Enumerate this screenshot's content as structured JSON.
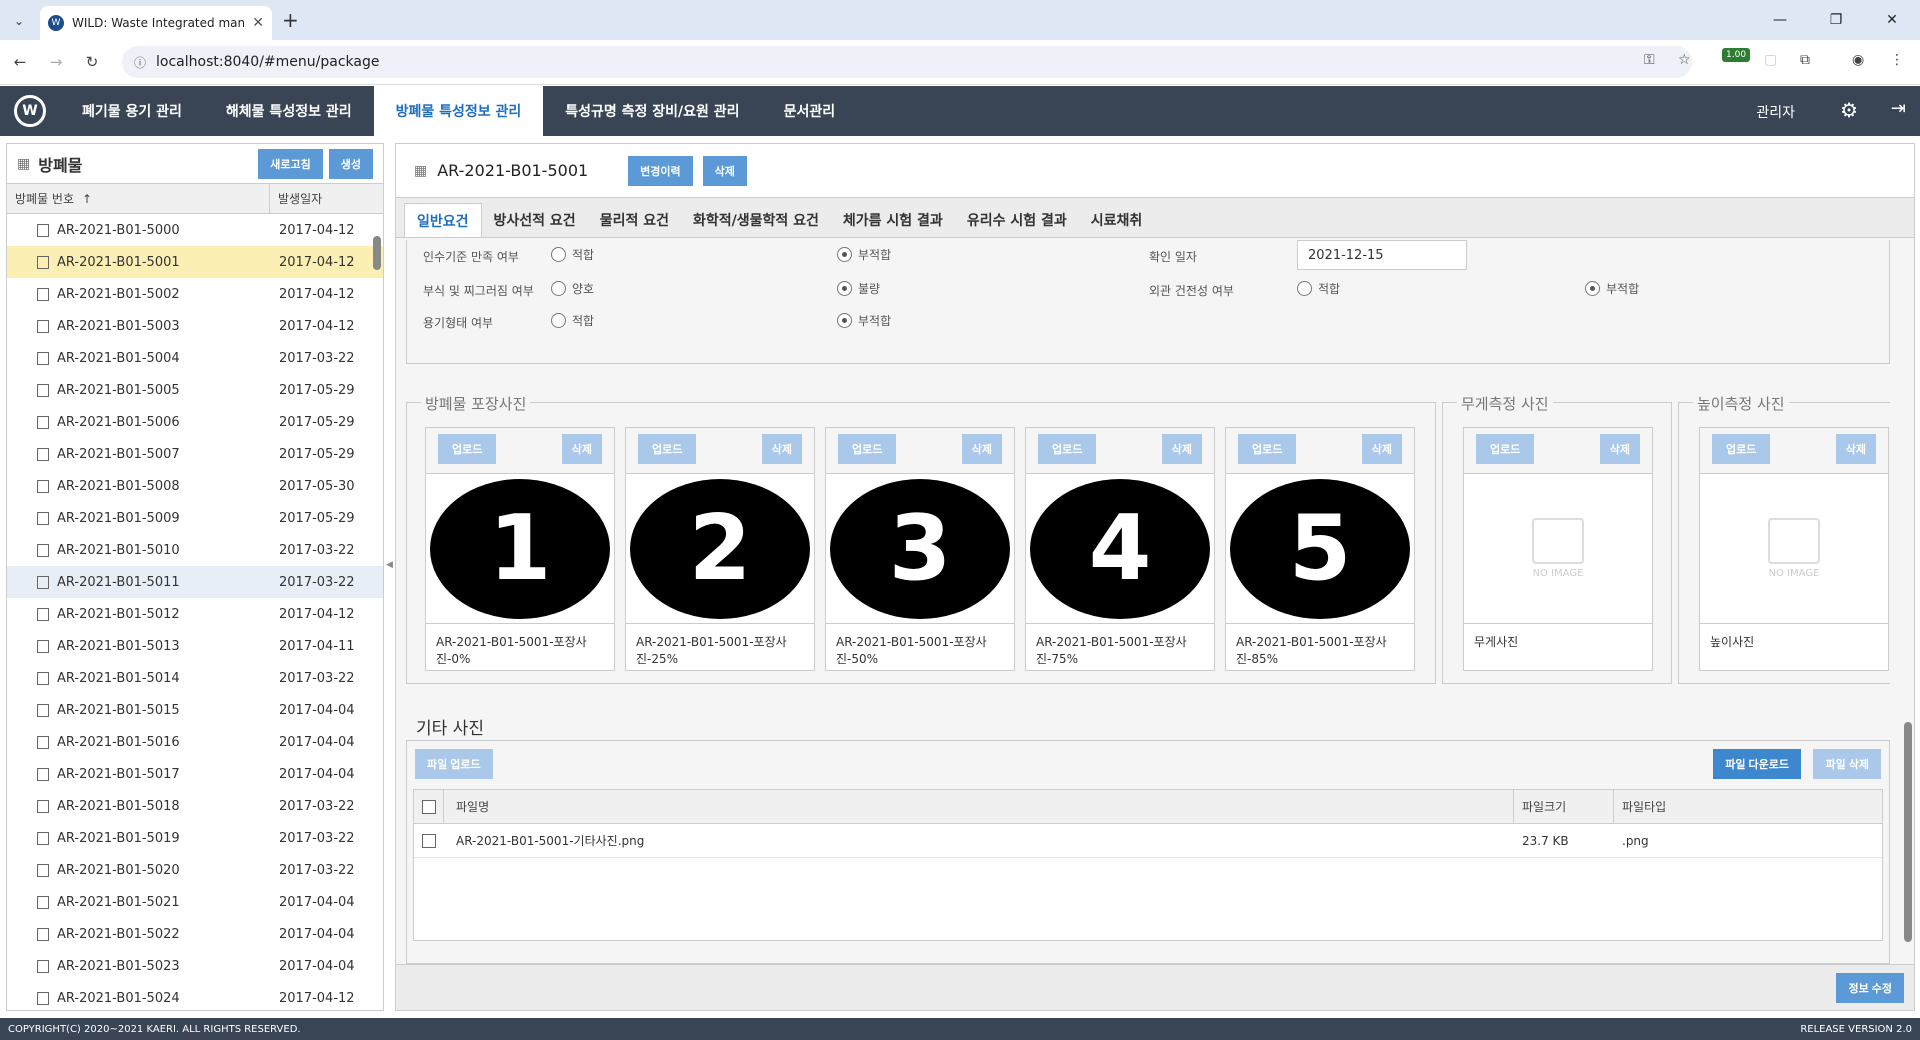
{
  "browser": {
    "tab_title": "WILD: Waste Integrated mana",
    "url": "localhost:8040/#menu/package",
    "ext_badge": "1.00"
  },
  "app": {
    "logo_text": "W",
    "menu": [
      {
        "label": "폐기물 용기 관리"
      },
      {
        "label": "해체물 특성정보 관리"
      },
      {
        "label": "방폐물 특성정보 관리"
      },
      {
        "label": "특성규명 측정 장비/요원 관리"
      },
      {
        "label": "문서관리"
      }
    ],
    "user": "관리자"
  },
  "left": {
    "title": "방폐물",
    "refresh_label": "새로고침",
    "create_label": "생성",
    "col_id": "방폐물 번호",
    "col_date": "발생일자",
    "sort_icon": "↑",
    "rows": [
      {
        "id": "AR-2021-B01-5000",
        "date": "2017-04-12"
      },
      {
        "id": "AR-2021-B01-5001",
        "date": "2017-04-12"
      },
      {
        "id": "AR-2021-B01-5002",
        "date": "2017-04-12"
      },
      {
        "id": "AR-2021-B01-5003",
        "date": "2017-04-12"
      },
      {
        "id": "AR-2021-B01-5004",
        "date": "2017-03-22"
      },
      {
        "id": "AR-2021-B01-5005",
        "date": "2017-05-29"
      },
      {
        "id": "AR-2021-B01-5006",
        "date": "2017-05-29"
      },
      {
        "id": "AR-2021-B01-5007",
        "date": "2017-05-29"
      },
      {
        "id": "AR-2021-B01-5008",
        "date": "2017-05-30"
      },
      {
        "id": "AR-2021-B01-5009",
        "date": "2017-05-29"
      },
      {
        "id": "AR-2021-B01-5010",
        "date": "2017-03-22"
      },
      {
        "id": "AR-2021-B01-5011",
        "date": "2017-03-22"
      },
      {
        "id": "AR-2021-B01-5012",
        "date": "2017-04-12"
      },
      {
        "id": "AR-2021-B01-5013",
        "date": "2017-04-11"
      },
      {
        "id": "AR-2021-B01-5014",
        "date": "2017-03-22"
      },
      {
        "id": "AR-2021-B01-5015",
        "date": "2017-04-04"
      },
      {
        "id": "AR-2021-B01-5016",
        "date": "2017-04-04"
      },
      {
        "id": "AR-2021-B01-5017",
        "date": "2017-04-04"
      },
      {
        "id": "AR-2021-B01-5018",
        "date": "2017-03-22"
      },
      {
        "id": "AR-2021-B01-5019",
        "date": "2017-03-22"
      },
      {
        "id": "AR-2021-B01-5020",
        "date": "2017-03-22"
      },
      {
        "id": "AR-2021-B01-5021",
        "date": "2017-04-04"
      },
      {
        "id": "AR-2021-B01-5022",
        "date": "2017-04-04"
      },
      {
        "id": "AR-2021-B01-5023",
        "date": "2017-04-04"
      },
      {
        "id": "AR-2021-B01-5024",
        "date": "2017-04-12"
      }
    ]
  },
  "detail": {
    "title": "AR-2021-B01-5001",
    "history_label": "변경이력",
    "delete_label": "삭제",
    "tabs": [
      {
        "label": "일반요건"
      },
      {
        "label": "방사선적 요건"
      },
      {
        "label": "물리적 요건"
      },
      {
        "label": "화학적/생물학적 요건"
      },
      {
        "label": "체가름 시험 결과"
      },
      {
        "label": "유리수 시험 결과"
      },
      {
        "label": "시료채취"
      }
    ],
    "form": {
      "accept_label": "인수기준 만족 여부",
      "accept_opt1": "적합",
      "accept_opt2": "부적합",
      "confirm_date_label": "확인 일자",
      "confirm_date": "2021-12-15",
      "corrosion_label": "부식 및 찌그러짐 여부",
      "corrosion_opt1": "양호",
      "corrosion_opt2": "불량",
      "soundness_label": "외관 건전성 여부",
      "soundness_opt1": "적합",
      "soundness_opt2": "부적합",
      "container_label": "용기형태 여부",
      "container_opt1": "적합",
      "container_opt2": "부적합"
    },
    "packaging": {
      "legend": "방폐물 포장사진",
      "upload_label": "업로드",
      "delete_label": "삭제",
      "photos": [
        {
          "num": "1",
          "caption": "AR-2021-B01-5001-포장사진-0%"
        },
        {
          "num": "2",
          "caption": "AR-2021-B01-5001-포장사진-25%"
        },
        {
          "num": "3",
          "caption": "AR-2021-B01-5001-포장사진-50%"
        },
        {
          "num": "4",
          "caption": "AR-2021-B01-5001-포장사진-75%"
        },
        {
          "num": "5",
          "caption": "AR-2021-B01-5001-포장사진-85%"
        }
      ]
    },
    "weight": {
      "legend": "무게측정 사진",
      "caption": "무게사진",
      "noimage": "NO IMAGE"
    },
    "height": {
      "legend": "높이측정 사진",
      "caption": "높이사진",
      "noimage": "NO IMAGE"
    },
    "etc": {
      "title": "기타 사진",
      "upload_label": "파일 업로드",
      "download_label": "파일 다운로드",
      "file_delete_label": "파일 삭제",
      "col_name": "파일명",
      "col_size": "파일크기",
      "col_type": "파일타입",
      "files": [
        {
          "name": "AR-2021-B01-5001-기타사진.png",
          "size": "23.7 KB",
          "type": ".png"
        }
      ]
    },
    "save_label": "정보 수정"
  },
  "footer": {
    "copyright": "COPYRIGHT(C) 2020~2021 KAERI. ALL RIGHTS RESERVED.",
    "version": "RELEASE VERSION 2.0"
  },
  "colors": {
    "accent": "#1f6fbf",
    "header_bg": "#394454",
    "button": "#5b9ad6",
    "selected_row": "#fcefb4"
  }
}
